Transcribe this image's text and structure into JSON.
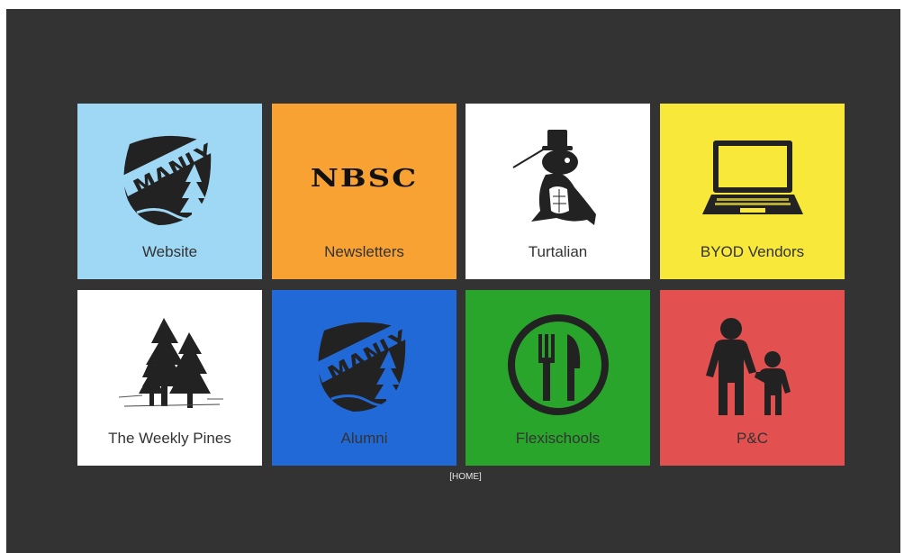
{
  "tiles": [
    {
      "label": "Website",
      "icon": "manly-crest-icon",
      "bg": "#9fd8f4"
    },
    {
      "label": "Newsletters",
      "icon": "nbsc-logo",
      "logo_text": "NBSC",
      "bg": "#f8a234"
    },
    {
      "label": "Turtalian",
      "icon": "turtle-icon",
      "bg": "#ffffff"
    },
    {
      "label": "BYOD Vendors",
      "icon": "laptop-icon",
      "bg": "#f7e83a"
    },
    {
      "label": "The Weekly Pines",
      "icon": "pine-trees-icon",
      "bg": "#ffffff"
    },
    {
      "label": "Alumni",
      "icon": "manly-crest-icon",
      "bg": "#2269d8"
    },
    {
      "label": "Flexischools",
      "icon": "cutlery-icon",
      "bg": "#2aa52c"
    },
    {
      "label": "P&C",
      "icon": "parent-child-icon",
      "bg": "#e25050"
    }
  ],
  "crest_text": "MANLY",
  "home_link": "[HOME]"
}
